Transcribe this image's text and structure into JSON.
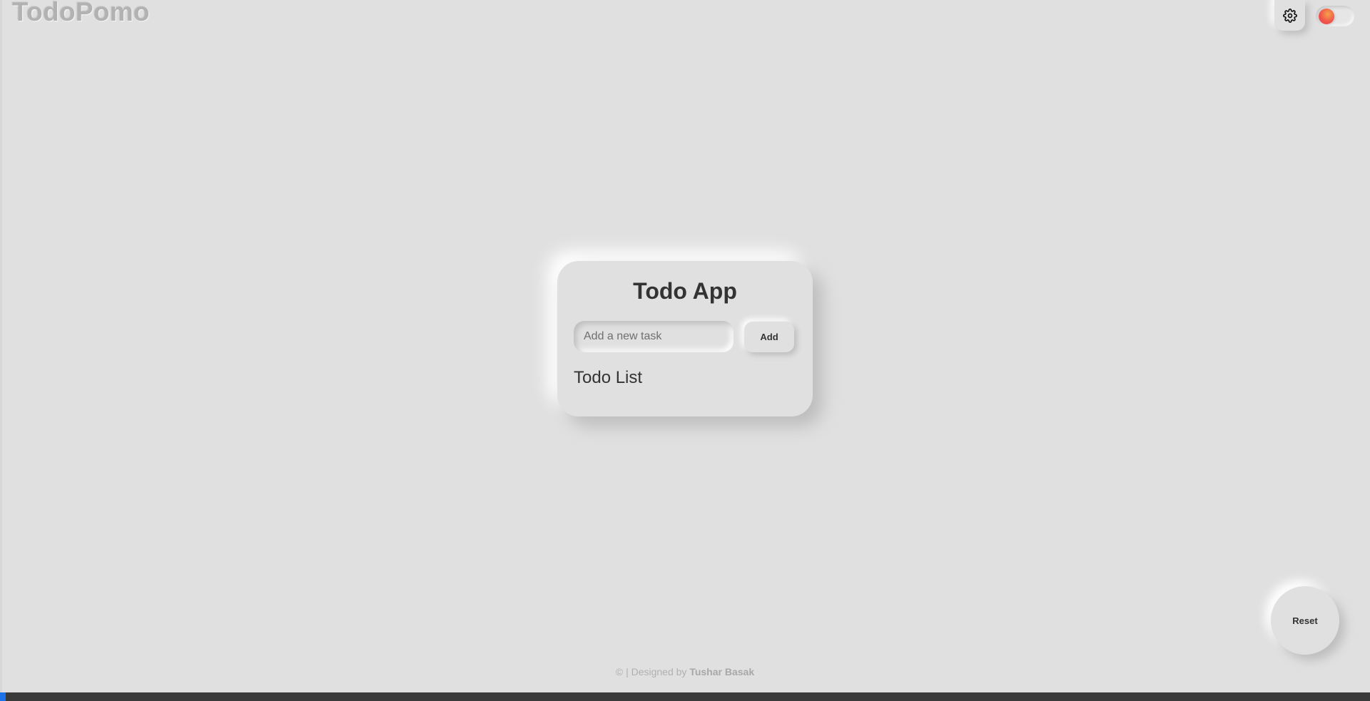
{
  "header": {
    "brand": "TodoPomo"
  },
  "toolbar": {
    "settings_icon": "gear-icon",
    "theme_toggle_icon": "sun-icon",
    "theme_toggle_colors": [
      "#f5a24a",
      "#e8434f"
    ]
  },
  "todo": {
    "title": "Todo App",
    "input_placeholder": "Add a new task",
    "input_value": "",
    "add_label": "Add",
    "list_heading": "Todo List",
    "items": []
  },
  "reset": {
    "label": "Reset"
  },
  "footer": {
    "prefix": "© | Designed by ",
    "author": "Tushar Basak"
  },
  "theme": {
    "background": "#e0e0e0",
    "text": "#333333",
    "accent": "#1a73e8"
  }
}
